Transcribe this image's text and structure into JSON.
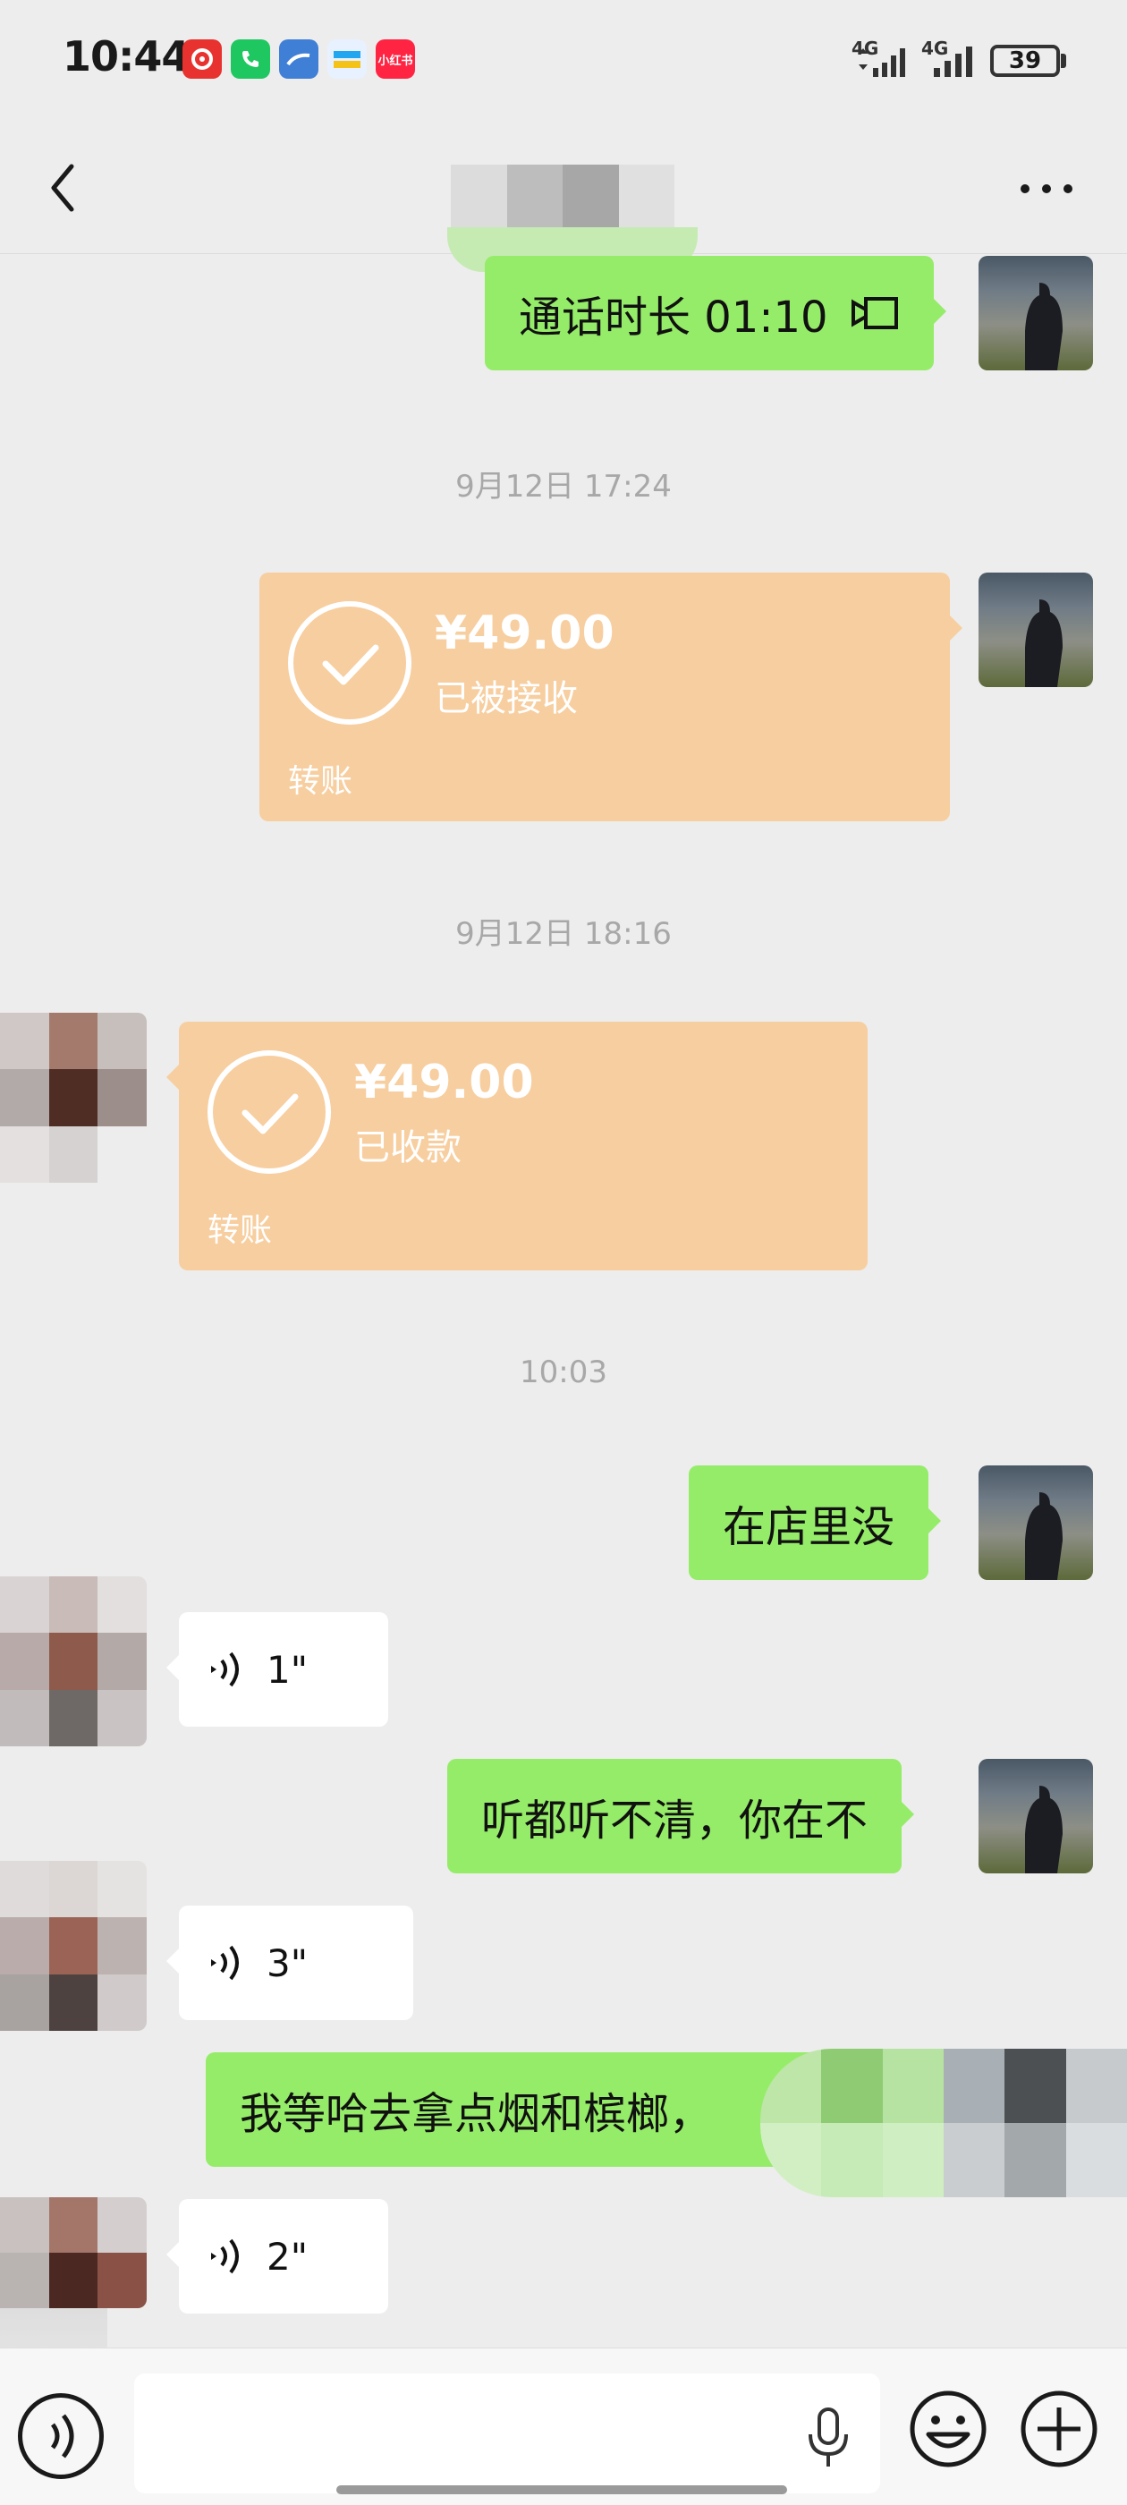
{
  "status_bar": {
    "time": "10:44",
    "network_1": "4G",
    "network_2": "4G",
    "battery": "39",
    "app_icons": [
      "netease-music-icon",
      "phone-app-icon",
      "browser-app-icon",
      "bank-app-icon",
      "xiaohongshu-icon"
    ],
    "xiaohongshu_label": "小红书"
  },
  "nav": {
    "back_icon": "chevron-left-icon",
    "more_icon": "ellipsis-icon"
  },
  "messages": [
    {
      "type": "call",
      "side": "right",
      "text": "通话时长 01:10"
    },
    {
      "type": "time",
      "text": "9月12日 17:24"
    },
    {
      "type": "transfer",
      "side": "right",
      "amount": "¥49.00",
      "status": "已被接收",
      "label": "转账"
    },
    {
      "type": "time",
      "text": "9月12日 18:16"
    },
    {
      "type": "transfer",
      "side": "left",
      "amount": "¥49.00",
      "status": "已收款",
      "label": "转账"
    },
    {
      "type": "time",
      "text": "10:03"
    },
    {
      "type": "text",
      "side": "right",
      "text": "在店里没"
    },
    {
      "type": "voice",
      "side": "left",
      "duration": "1\""
    },
    {
      "type": "text",
      "side": "right",
      "text": "听都听不清，你在不"
    },
    {
      "type": "voice",
      "side": "left",
      "duration": "3\""
    },
    {
      "type": "text",
      "side": "right",
      "text": "我等哈去拿点烟和槟榔，"
    },
    {
      "type": "voice",
      "side": "left",
      "duration": "2\""
    }
  ],
  "input_bar": {
    "placeholder": "",
    "voice_icon": "voice-mode-icon",
    "mic_icon": "microphone-icon",
    "emoji_icon": "emoji-icon",
    "plus_icon": "plus-icon"
  },
  "colors": {
    "background": "#ededed",
    "self_bubble": "#95ec69",
    "other_bubble": "#ffffff",
    "transfer_bubble": "#f7ce9f",
    "timestamp": "#a8a8a8"
  }
}
